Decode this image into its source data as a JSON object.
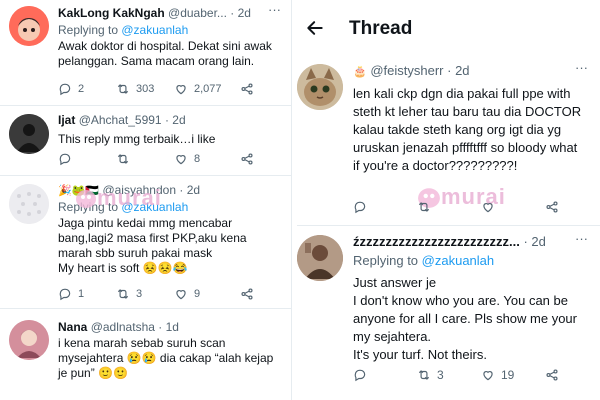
{
  "left_feed": {
    "tweets": [
      {
        "name": "KakLong KakNgah",
        "handle": "@duaber...",
        "time": "· 2d",
        "replying_prefix": "Replying to ",
        "replying_to": "@zakuanlah",
        "lines": [
          "Awak doktor di hospital. Dekat sini awak",
          "pelanggan. Sama macam orang lain."
        ],
        "replies": "2",
        "retweets": "303",
        "likes": "2,077"
      },
      {
        "name": "Ijat",
        "handle": "@Ahchat_5991",
        "time": "· 2d",
        "lines": [
          "This reply mmg terbaik…i like"
        ],
        "replies": "",
        "retweets": "",
        "likes": "8"
      },
      {
        "name": "🎉🐸🇵🇸",
        "handle": "@aisyahndon",
        "time": "· 2d",
        "replying_prefix": "Replying to ",
        "replying_to": "@zakuanlah",
        "lines": [
          "Jaga pintu kedai mmg mencabar",
          "bang,lagi2 masa first PKP,aku kena",
          "marah sbb suruh pakai mask",
          "My heart is soft 😣😣😂"
        ],
        "replies": "1",
        "retweets": "3",
        "likes": "9"
      },
      {
        "name": "Nana",
        "handle": "@adlnatsha",
        "time": "· 1d",
        "lines": [
          "i kena marah sebab suruh scan",
          "mysejahtera 😢😢 dia cakap “alah kejap",
          "je pun” 🙂🙂"
        ],
        "replies": "",
        "retweets": "",
        "likes": ""
      }
    ]
  },
  "thread": {
    "title": "Thread",
    "tweets": [
      {
        "name": "🎂",
        "handle": "@feistysherr",
        "time": "· 2d",
        "lines": [
          "len kali ckp dgn dia pakai full ppe with",
          "steth kt leher tau baru tau dia DOCTOR",
          "kalau takde steth kang org igt dia yg",
          "uruskan jenazah pfffftfff so bloody what",
          "if you're a doctor?????????!"
        ],
        "replies": "",
        "retweets": "",
        "likes": ""
      },
      {
        "name": "źzzzzzzzzzzzzzzzzzzzzzzz...",
        "handle": "",
        "time": "· 2d",
        "replying_prefix": "Replying to ",
        "replying_to": "@zakuanlah",
        "lines": [
          "Just answer je",
          "I don't know who you are. You can be",
          "anyone for all I care. Pls show me your",
          "my sejahtera.",
          "It's your turf. Not theirs."
        ],
        "replies": "",
        "retweets": "3",
        "likes": "19"
      }
    ]
  },
  "watermark": {
    "text": "murai",
    "color": "#e6a7cf"
  },
  "colors": {
    "accent": "#1d9bf0",
    "muted": "#536471",
    "text": "#0f1419"
  },
  "icons": [
    "reply-icon",
    "retweet-icon",
    "like-icon",
    "share-icon",
    "back-arrow-icon",
    "more-icon"
  ]
}
